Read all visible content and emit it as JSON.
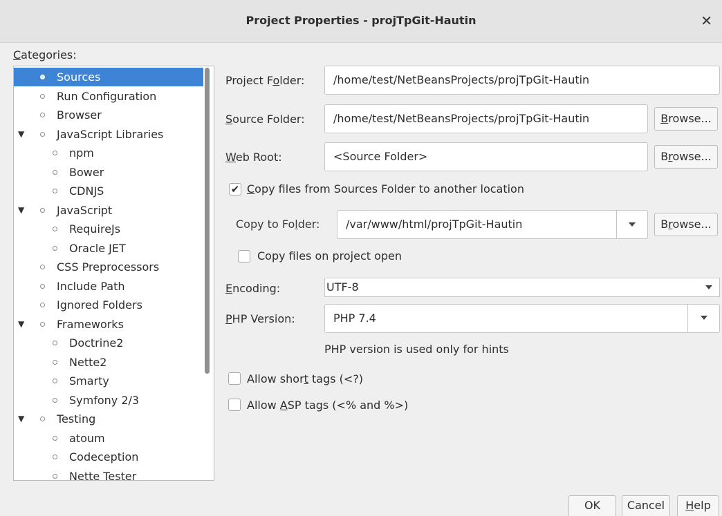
{
  "window": {
    "title": "Project Properties - projTpGit-Hautin"
  },
  "categories": {
    "label_first": "C",
    "label_rest": "ategories:",
    "items": [
      {
        "label": "Sources",
        "level": 0,
        "expander": false,
        "selected": true
      },
      {
        "label": "Run Configuration",
        "level": 0,
        "expander": false
      },
      {
        "label": "Browser",
        "level": 0,
        "expander": false
      },
      {
        "label": "JavaScript Libraries",
        "level": 0,
        "expander": true
      },
      {
        "label": "npm",
        "level": 1,
        "expander": false
      },
      {
        "label": "Bower",
        "level": 1,
        "expander": false
      },
      {
        "label": "CDNJS",
        "level": 1,
        "expander": false
      },
      {
        "label": "JavaScript",
        "level": 0,
        "expander": true
      },
      {
        "label": "RequireJs",
        "level": 1,
        "expander": false
      },
      {
        "label": "Oracle JET",
        "level": 1,
        "expander": false
      },
      {
        "label": "CSS Preprocessors",
        "level": 0,
        "expander": false
      },
      {
        "label": "Include Path",
        "level": 0,
        "expander": false
      },
      {
        "label": "Ignored Folders",
        "level": 0,
        "expander": false
      },
      {
        "label": "Frameworks",
        "level": 0,
        "expander": true
      },
      {
        "label": "Doctrine2",
        "level": 1,
        "expander": false
      },
      {
        "label": "Nette2",
        "level": 1,
        "expander": false
      },
      {
        "label": "Smarty",
        "level": 1,
        "expander": false
      },
      {
        "label": "Symfony 2/3",
        "level": 1,
        "expander": false
      },
      {
        "label": "Testing",
        "level": 0,
        "expander": true
      },
      {
        "label": "atoum",
        "level": 1,
        "expander": false
      },
      {
        "label": "Codeception",
        "level": 1,
        "expander": false
      },
      {
        "label": "Nette Tester",
        "level": 1,
        "expander": false
      }
    ]
  },
  "form": {
    "project_folder": {
      "label_a": "Project F",
      "label_u": "o",
      "label_b": "lder:",
      "value": "/home/test/NetBeansProjects/projTpGit-Hautin"
    },
    "source_folder": {
      "label_u": "S",
      "label_b": "ource Folder:",
      "value": "/home/test/NetBeansProjects/projTpGit-Hautin",
      "browse_u": "B",
      "browse_b": "rowse..."
    },
    "web_root": {
      "label_u": "W",
      "label_b": "eb Root:",
      "value": "<Source Folder>",
      "browse_a": "B",
      "browse_u": "r",
      "browse_b": "owse..."
    },
    "copy_files": {
      "checked": true,
      "label_u": "C",
      "label_b": "opy files from Sources Folder to another location"
    },
    "copy_to_folder": {
      "label_a": "Copy to Fo",
      "label_u": "l",
      "label_b": "der:",
      "value": "/var/www/html/projTpGit-Hautin",
      "browse_a": "B",
      "browse_u": "r",
      "browse_b": "owse..."
    },
    "copy_on_open": {
      "checked": false,
      "label_a": "Copy files on pro",
      "label_u": "j",
      "label_b": "ect open"
    },
    "encoding": {
      "label_u": "E",
      "label_b": "ncoding:",
      "value": "UTF-8"
    },
    "php_version": {
      "label_u": "P",
      "label_b": "HP Version:",
      "value": "PHP 7.4",
      "hint": "PHP version is used only for hints"
    },
    "short_tags": {
      "checked": false,
      "label_a": "Allow shor",
      "label_u": "t",
      "label_b": " tags (<?)"
    },
    "asp_tags": {
      "checked": false,
      "label_a": "Allow ",
      "label_u": "A",
      "label_b": "SP tags (<% and %>)"
    }
  },
  "buttons": {
    "ok": "OK",
    "cancel": "Cancel",
    "help_u": "H",
    "help_b": "elp"
  }
}
